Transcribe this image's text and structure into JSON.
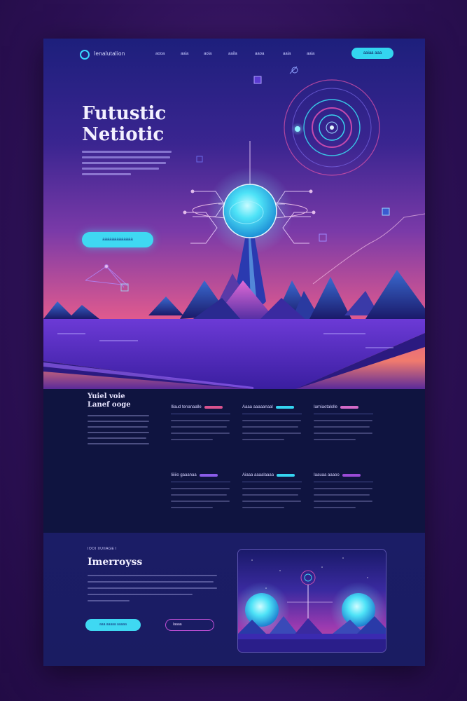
{
  "nav": {
    "brand": "Ienalutalion",
    "links": [
      "aooa",
      "aaia",
      "aoia",
      "aaila",
      "aaoa",
      "aaia",
      "aaia"
    ],
    "cta": "aaiaa aaa"
  },
  "hero": {
    "title_line1": "Futustic",
    "title_line2": "Netiotic",
    "cta": "aaaaaaaaaaaaa"
  },
  "features": {
    "heading_line1": "Yuiel voie",
    "heading_line2": "Lanef ooge",
    "cards": [
      {
        "title": "Iliaud tenanaalle",
        "bar_color": "#d9538e"
      },
      {
        "title": "Aaaa aaaaanaal",
        "bar_color": "#35d4f0"
      },
      {
        "title": "Iarniaotalolle",
        "bar_color": "#d46ac8"
      },
      {
        "title": "Iiiiiio gaaanaa",
        "bar_color": "#8a5ce8"
      },
      {
        "title": "Aiaaa aaaalaaaa",
        "bar_color": "#35d4f0"
      },
      {
        "title": "Iaauaa aaaoo",
        "bar_color": "#9a4ad6"
      }
    ]
  },
  "bottom": {
    "kicker": "IOOI IIUIIAGE I",
    "title": "Imerroyss",
    "btn_primary": "aaa aaaaa aaaaa",
    "btn_secondary": "Iaaaa"
  },
  "colors": {
    "accent_cyan": "#3fd8f2",
    "accent_pink": "#d9538e",
    "accent_purple": "#8a5ce8",
    "panel_dark": "#0f1440"
  }
}
